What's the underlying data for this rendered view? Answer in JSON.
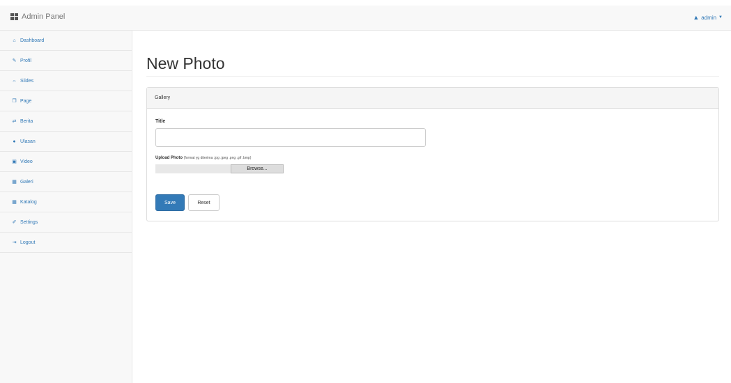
{
  "navbar": {
    "brand": "Admin Panel",
    "brand_icon": "grid-icon",
    "user_icon": "user-icon",
    "user_name": "admin"
  },
  "sidebar": {
    "items": [
      {
        "label": "Dashboard",
        "icon": "home-icon",
        "glyph": "⌂"
      },
      {
        "label": "Profil",
        "icon": "edit-icon",
        "glyph": "✎"
      },
      {
        "label": "Slides",
        "icon": "slides-icon",
        "glyph": "⇔"
      },
      {
        "label": "Page",
        "icon": "page-icon",
        "glyph": "❐"
      },
      {
        "label": "Berita",
        "icon": "news-icon",
        "glyph": "⇄"
      },
      {
        "label": "Ulasan",
        "icon": "comment-icon",
        "glyph": "●"
      },
      {
        "label": "Video",
        "icon": "video-icon",
        "glyph": "▣"
      },
      {
        "label": "Galeri",
        "icon": "gallery-icon",
        "glyph": "▦"
      },
      {
        "label": "Katalog",
        "icon": "catalog-icon",
        "glyph": "▦"
      },
      {
        "label": "Settings",
        "icon": "wrench-icon",
        "glyph": "✐"
      },
      {
        "label": "Logout",
        "icon": "logout-icon",
        "glyph": "⇥"
      }
    ]
  },
  "main": {
    "page_title": "New Photo",
    "panel": {
      "heading": "Gallery",
      "title_label": "Title",
      "title_value": "",
      "upload_label": "Upload Photo",
      "upload_hint": "(format yg diterima .jpg .jpeg .png .gif .bmp)",
      "browse_label": "Browse...",
      "save_label": "Save",
      "reset_label": "Reset"
    }
  },
  "colors": {
    "link": "#337ab7",
    "primary_button": "#337ab7",
    "panel_heading_bg": "#f5f5f5",
    "sidebar_bg": "#f8f8f8"
  }
}
